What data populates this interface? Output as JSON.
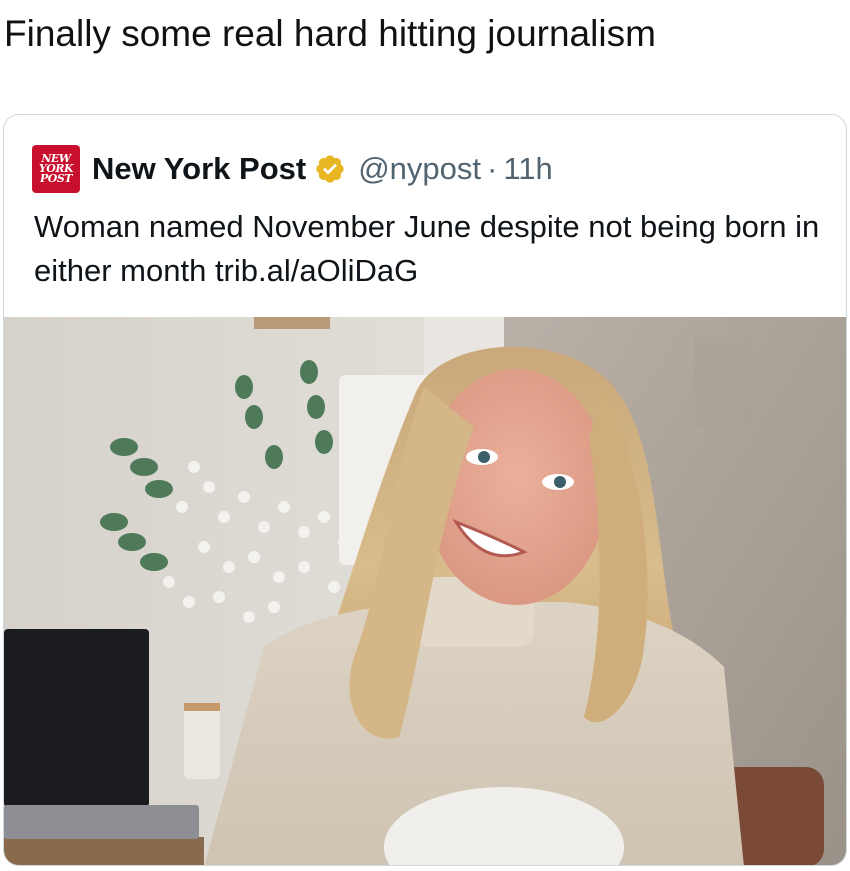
{
  "post_caption": "Finally some real hard hitting journalism",
  "embedded_tweet": {
    "logo_lines": [
      "NEW",
      "YORK",
      "POST"
    ],
    "display_name": "New York Post",
    "verified_icon": "verified-badge-gold-icon",
    "handle": "@nypost",
    "separator": "·",
    "time": "11h",
    "text": "Woman named November June despite not being born in either month ",
    "link_text": "trib.al/aOliDaG"
  },
  "colors": {
    "logo_red": "#c8102e",
    "verified_gold": "#e8b623",
    "secondary_text": "#536471",
    "card_border": "#cfd9de"
  }
}
